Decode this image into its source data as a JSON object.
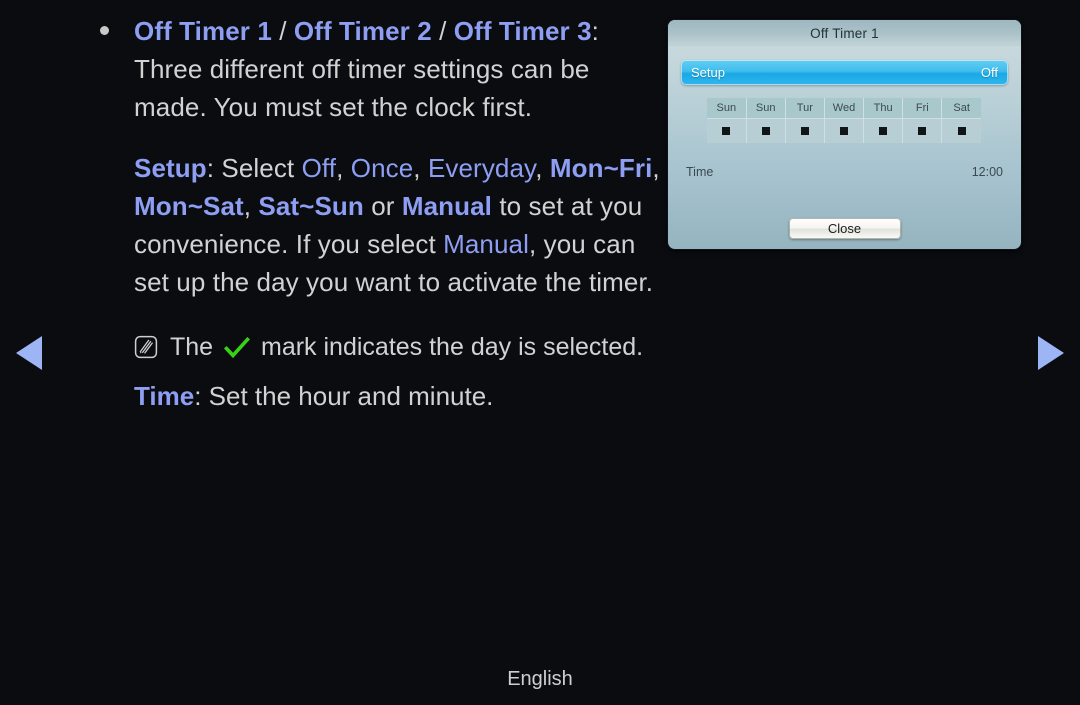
{
  "nav": {
    "prev_label": "Previous page",
    "next_label": "Next page"
  },
  "content": {
    "bullet_heading": {
      "part1": "Off Timer 1",
      "sep1": " / ",
      "part2": "Off Timer 2",
      "sep2": " / ",
      "part3": "Off Timer 3",
      "colon": ":"
    },
    "bullet_body": "Three different off timer settings can be made. You must set the clock first.",
    "setup_paragraph": {
      "label": "Setup",
      "after_label": ": Select ",
      "opt1": "Off",
      "c1": ", ",
      "opt2": "Once",
      "c2": ", ",
      "opt3": "Everyday",
      "c3": ", ",
      "opt4": "Mon~Fri",
      "c4": ", ",
      "opt5": "Mon~Sat",
      "c5": ", ",
      "opt6": "Sat~Sun",
      "or_text": " or ",
      "opt7": "Manual",
      "tail1": " to set at you convenience. If you select ",
      "opt8": "Manual",
      "tail2": ", you can set up the day you want to activate the timer."
    },
    "note": {
      "icon_name": "note-icon",
      "text_before": "The",
      "check_icon_name": "green-check-icon",
      "text_after": "mark indicates the day is selected."
    },
    "time_paragraph": {
      "label": "Time",
      "text": ": Set the hour and minute."
    }
  },
  "osd": {
    "title": "Off Timer 1",
    "setup_row": {
      "label": "Setup",
      "value": "Off"
    },
    "day_headers": [
      "Sun",
      "Sun",
      "Tur",
      "Wed",
      "Thu",
      "Fri",
      "Sat"
    ],
    "day_marks": [
      "■",
      "■",
      "■",
      "■",
      "■",
      "■",
      "■"
    ],
    "time_row": {
      "label": "Time",
      "value": "12:00"
    },
    "close_label": "Close"
  },
  "footer": {
    "language": "English"
  },
  "colors": {
    "background": "#0a0c10",
    "highlight_blue": "#8e9ef2",
    "body_text": "#d2d2d2",
    "check_green": "#39d117",
    "osd_accent": "#31b6ec",
    "arrow_blue": "#9db4f5"
  }
}
